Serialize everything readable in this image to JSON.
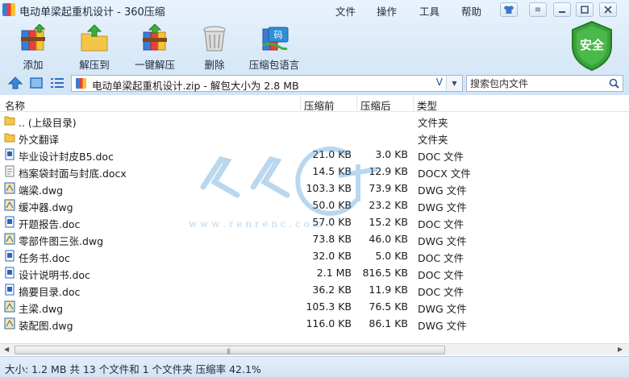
{
  "window": {
    "title": "电动单梁起重机设计 - 360压缩",
    "menu": [
      "文件",
      "操作",
      "工具",
      "帮助"
    ]
  },
  "toolbar": {
    "buttons": [
      {
        "label": "添加",
        "icon": "add-books-icon"
      },
      {
        "label": "解压到",
        "icon": "extract-folder-icon"
      },
      {
        "label": "一键解压",
        "icon": "one-click-extract-icon"
      },
      {
        "label": "删除",
        "icon": "trash-can-icon"
      },
      {
        "label": "压缩包语言",
        "icon": "language-code-icon"
      }
    ],
    "safe_badge": "安全"
  },
  "address": {
    "path": "电动单梁起重机设计.zip - 解包大小为 2.8 MB",
    "dropdown_glyph": "V"
  },
  "search": {
    "placeholder": "搜索包内文件"
  },
  "columns": {
    "name": "名称",
    "packed": "压缩前",
    "unpacked": "压缩后",
    "type": "类型"
  },
  "files": [
    {
      "name": ".. (上级目录)",
      "before": "",
      "after": "",
      "type": "文件夹",
      "icon": "folder-icon"
    },
    {
      "name": "外文翻译",
      "before": "",
      "after": "",
      "type": "文件夹",
      "icon": "folder-icon"
    },
    {
      "name": "毕业设计封皮B5.doc",
      "before": "21.0 KB",
      "after": "3.0 KB",
      "type": "DOC 文件",
      "icon": "doc-file-icon"
    },
    {
      "name": "档案袋封面与封底.docx",
      "before": "14.5 KB",
      "after": "12.9 KB",
      "type": "DOCX 文件",
      "icon": "docx-file-icon"
    },
    {
      "name": "端梁.dwg",
      "before": "103.3 KB",
      "after": "73.9 KB",
      "type": "DWG 文件",
      "icon": "dwg-file-icon"
    },
    {
      "name": "缓冲器.dwg",
      "before": "50.0 KB",
      "after": "23.2 KB",
      "type": "DWG 文件",
      "icon": "dwg-file-icon"
    },
    {
      "name": "开题报告.doc",
      "before": "57.0 KB",
      "after": "15.2 KB",
      "type": "DOC 文件",
      "icon": "doc-file-icon"
    },
    {
      "name": "零部件图三张.dwg",
      "before": "73.8 KB",
      "after": "46.0 KB",
      "type": "DWG 文件",
      "icon": "dwg-file-icon"
    },
    {
      "name": "任务书.doc",
      "before": "32.0 KB",
      "after": "5.0 KB",
      "type": "DOC 文件",
      "icon": "doc-file-icon"
    },
    {
      "name": "设计说明书.doc",
      "before": "2.1 MB",
      "after": "816.5 KB",
      "type": "DOC 文件",
      "icon": "doc-file-icon"
    },
    {
      "name": "摘要目录.doc",
      "before": "36.2 KB",
      "after": "11.9 KB",
      "type": "DOC 文件",
      "icon": "doc-file-icon"
    },
    {
      "name": "主梁.dwg",
      "before": "105.3 KB",
      "after": "76.5 KB",
      "type": "DWG 文件",
      "icon": "dwg-file-icon"
    },
    {
      "name": "装配图.dwg",
      "before": "116.0 KB",
      "after": "86.1 KB",
      "type": "DWG 文件",
      "icon": "dwg-file-icon"
    }
  ],
  "status": {
    "text": "大小: 1.2 MB 共 13 个文件和 1 个文件夹 压缩率 42.1%"
  },
  "watermark": {
    "text": "w w w . r e n r e n         c . c o m"
  },
  "colors": {
    "accent": "#2b6fc2",
    "safe_green": "#3aa33a",
    "folder_yellow": "#f3c64a"
  }
}
